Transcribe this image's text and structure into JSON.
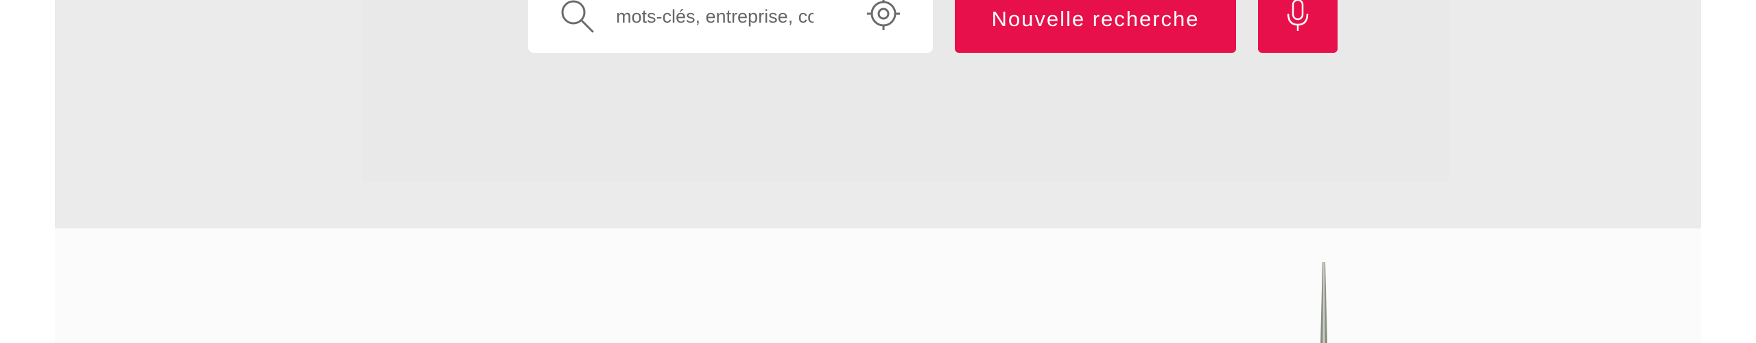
{
  "search": {
    "placeholder": "mots-clés, entreprise, comp",
    "icon": "search-icon",
    "locate_icon": "crosshair-locate-icon"
  },
  "actions": {
    "new_search_label": "Nouvelle recherche",
    "mic_icon": "microphone-icon"
  },
  "colors": {
    "accent": "#e8104a",
    "band_background": "#ebebeb",
    "lower_background": "#fbfbfb",
    "icon_gray": "#6b6b6b"
  }
}
